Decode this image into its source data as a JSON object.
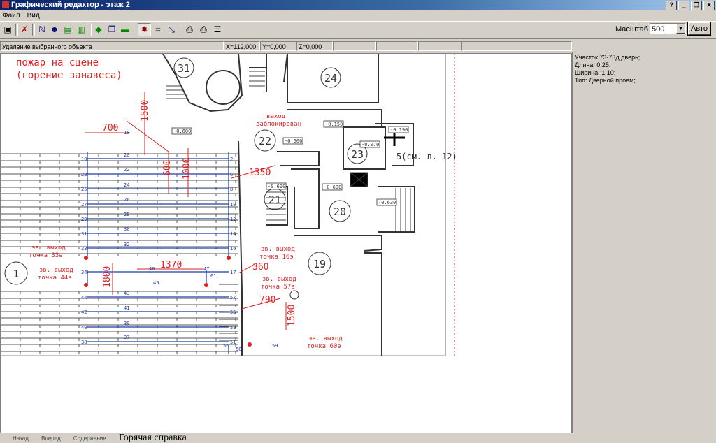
{
  "window": {
    "title": "Графический редактор - этаж 2",
    "buttons": [
      "?",
      "_",
      "❐",
      "✕"
    ]
  },
  "menu": [
    "Файл",
    "Вид"
  ],
  "toolbar": {
    "scale_label": "Масштаб 1:",
    "scale_value": "500",
    "auto_label": "Авто",
    "icons": [
      "save-icon",
      "delete-icon",
      "line-icon",
      "people-icon",
      "exit-icon",
      "exit2-icon",
      "green-arrow-icon",
      "copy-icon",
      "green-bar-icon",
      "bug-icon",
      "properties-icon",
      "route-icon",
      "print-preview-icon",
      "print-icon",
      "layers-icon"
    ]
  },
  "status": {
    "action": "Удаление выбранного объекта",
    "x": "X=112,000",
    "y": "Y=0,000",
    "z": "Z=0,000"
  },
  "info": {
    "lines": [
      "Участок 73-73д дверь;",
      "Длина: 0,25;",
      "Ширина: 1,10;",
      "Тип: Дверной проем;"
    ]
  },
  "plan": {
    "fire_line1": "пожар на сцене",
    "fire_line2": "(горение занавеса)",
    "blocked1": "выход",
    "blocked2": "заблокирован",
    "rooms": [
      "31",
      "24",
      "22",
      "23",
      "21",
      "20",
      "19",
      "1"
    ],
    "room5": "5(см. л. 12)",
    "dims": [
      "700",
      "1500",
      "1350",
      "1370",
      "1800",
      "360",
      "790",
      "1500",
      "1000",
      "600"
    ],
    "exits": [
      {
        "l1": "эв. выход",
        "l2": "точка 33э"
      },
      {
        "l1": "эв. выход",
        "l2": "точка 44э"
      },
      {
        "l1": "эв. выход",
        "l2": "точка 16э"
      },
      {
        "l1": "эв. выход",
        "l2": "точка 57э"
      },
      {
        "l1": "эв. выход",
        "l2": "точка 60э"
      }
    ],
    "levels": [
      "-0.600",
      "-0.150",
      "-0.600",
      "-0.190",
      "-0.070",
      "-0.600",
      "-0.600",
      "-0.630"
    ],
    "left_nums": [
      "19",
      "23",
      "25",
      "27",
      "29",
      "31",
      "33",
      "34",
      "44",
      "42",
      "40",
      "38"
    ],
    "right_nums": [
      "2",
      "6",
      "8",
      "10",
      "12",
      "14",
      "16",
      "17",
      "57",
      "55",
      "53",
      "51"
    ],
    "mid_nums": [
      "18",
      "20",
      "22",
      "24",
      "26",
      "28",
      "30",
      "32",
      "45",
      "46",
      "47",
      "43",
      "41",
      "39",
      "37",
      "56",
      "58",
      "59",
      "61"
    ]
  },
  "bottom": {
    "back": "Назад",
    "forward": "Вперед",
    "contents": "Содержание",
    "help": "Горячая справка"
  }
}
